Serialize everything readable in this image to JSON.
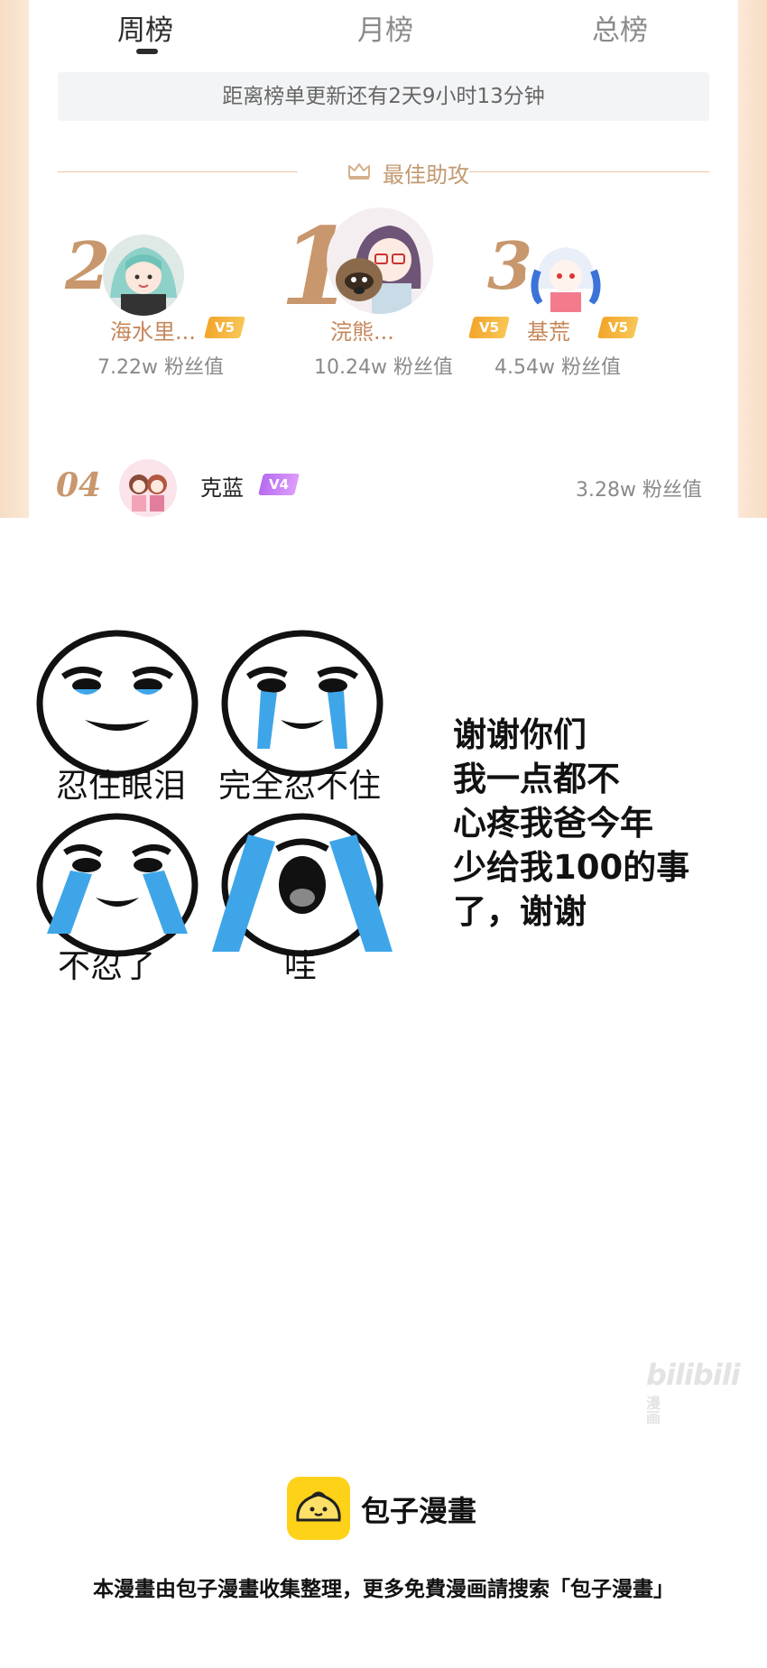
{
  "tabs": [
    {
      "label": "周榜",
      "active": true
    },
    {
      "label": "月榜",
      "active": false
    },
    {
      "label": "总榜",
      "active": false
    }
  ],
  "countdown_text": "距离榜单更新还有2天9小时13分钟",
  "section_title": "最佳助攻",
  "podium": [
    {
      "rank": "2",
      "name": "海水里...",
      "level": "V5",
      "fans": "7.22w 粉丝值"
    },
    {
      "rank": "1",
      "name": "浣熊...",
      "level": "V5",
      "fans": "10.24w 粉丝值"
    },
    {
      "rank": "3",
      "name": "基荒",
      "level": "V5",
      "fans": "4.54w 粉丝值"
    }
  ],
  "list": [
    {
      "rank": "04",
      "name": "克蓝",
      "level": "V4",
      "fans": "3.28w 粉丝值"
    }
  ],
  "meme": {
    "captions": [
      "忍住眼泪",
      "完全忍不住",
      "不忍了",
      "哇"
    ]
  },
  "speech_lines": [
    "谢谢你们",
    "我一点都不",
    "心疼我爸今年",
    "少给我100的事",
    "了，谢谢"
  ],
  "watermark": {
    "brand": "bilibili",
    "tag": "漫画"
  },
  "footer": {
    "app_name": "包子漫畫",
    "note": "本漫畫由包子漫畫收集整理，更多免費漫画請搜索「包子漫畫」"
  },
  "colors": {
    "gold": "#c8976d",
    "badge_v5": "#f3a52a",
    "badge_v4": "#c07af2",
    "logo_yellow": "#ffd21a"
  }
}
